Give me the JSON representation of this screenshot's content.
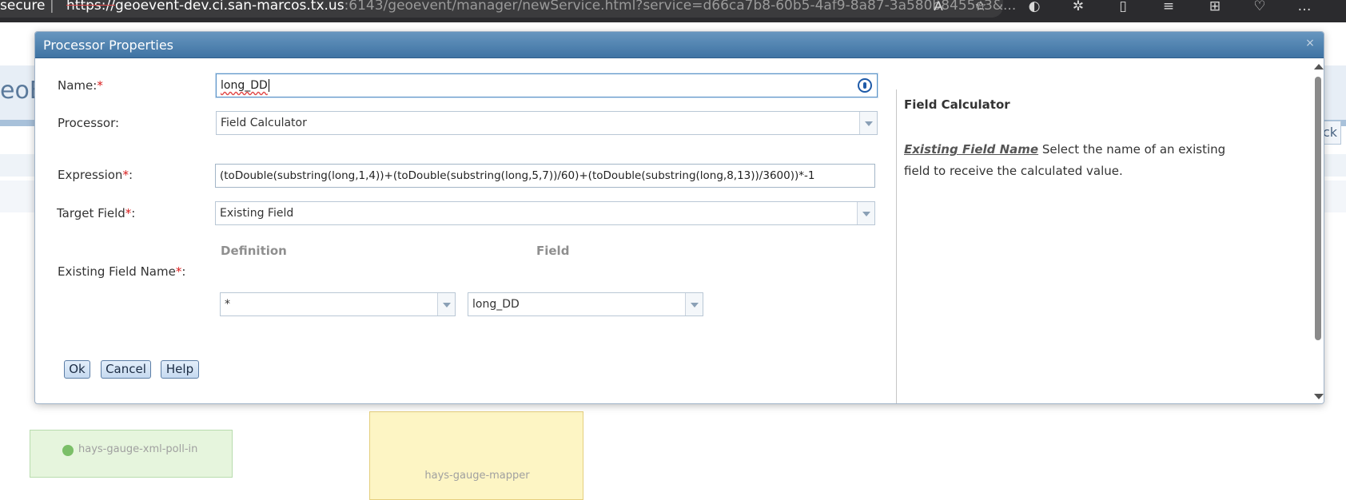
{
  "browser": {
    "url_prefix": "secure",
    "url_separator": "|",
    "url_scheme": "https://",
    "url_host": "geoevent-dev.ci.san-marcos.tx.us",
    "url_path": ":6143/geoevent/manager/newService.html?service=d66ca7b8-60b5-4af9-8a87-3a580b8455e3&..."
  },
  "background": {
    "logo_text": "eoE",
    "back_label": "ck",
    "card_left_label": "hays-gauge-xml-poll-in",
    "card_middle_label": "hays-gauge-mapper"
  },
  "dialog": {
    "title": "Processor Properties",
    "close_label": "×",
    "name": {
      "label": "Name:",
      "required_mark": "*",
      "value": "long_DD"
    },
    "processor": {
      "label": "Processor:",
      "value": "Field Calculator"
    },
    "expression": {
      "label": "Expression",
      "required_mark": "*",
      "colon": ":",
      "value": "(toDouble(substring(long,1,4))+(toDouble(substring(long,5,7))/60)+(toDouble(substring(long,8,13))/3600))*-1"
    },
    "target_field": {
      "label": "Target Field",
      "required_mark": "*",
      "colon": ":",
      "value": "Existing Field"
    },
    "existing_field": {
      "label": "Existing Field Name",
      "required_mark": "*",
      "colon": ":",
      "definition_header": "Definition",
      "field_header": "Field",
      "definition_value": "*",
      "field_value": "long_DD"
    },
    "buttons": {
      "ok": "Ok",
      "cancel": "Cancel",
      "help": "Help"
    },
    "help_panel": {
      "title": "Field Calculator",
      "term": "Existing Field Name",
      "description": "Select the name of an existing field to receive the calculated value."
    }
  }
}
